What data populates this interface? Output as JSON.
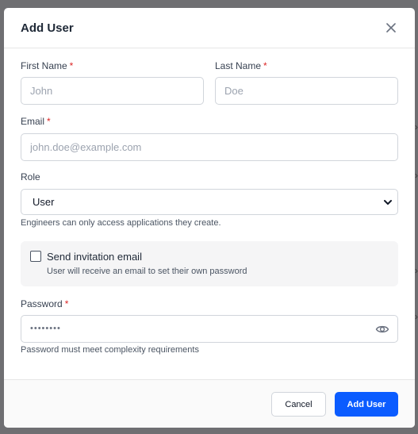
{
  "dialog": {
    "title": "Add User"
  },
  "form": {
    "first_name": {
      "label": "First Name",
      "required_mark": "*",
      "placeholder": "John",
      "value": ""
    },
    "last_name": {
      "label": "Last Name",
      "required_mark": "*",
      "placeholder": "Doe",
      "value": ""
    },
    "email": {
      "label": "Email",
      "required_mark": "*",
      "placeholder": "john.doe@example.com",
      "value": ""
    },
    "role": {
      "label": "Role",
      "selected": "User",
      "hint": "Engineers can only access applications they create."
    },
    "invitation": {
      "checked": false,
      "title": "Send invitation email",
      "description": "User will receive an email to set their own password"
    },
    "password": {
      "label": "Password",
      "required_mark": "*",
      "masked_value": "••••••••",
      "hint": "Password must meet complexity requirements"
    }
  },
  "footer": {
    "cancel_label": "Cancel",
    "submit_label": "Add User"
  },
  "icons": {
    "close": "close-icon",
    "dropdown": "chevron-down-icon",
    "visibility": "eye-icon"
  },
  "colors": {
    "primary": "#0b5cff",
    "required": "#dc2626",
    "overlay": "#6f6f72"
  }
}
